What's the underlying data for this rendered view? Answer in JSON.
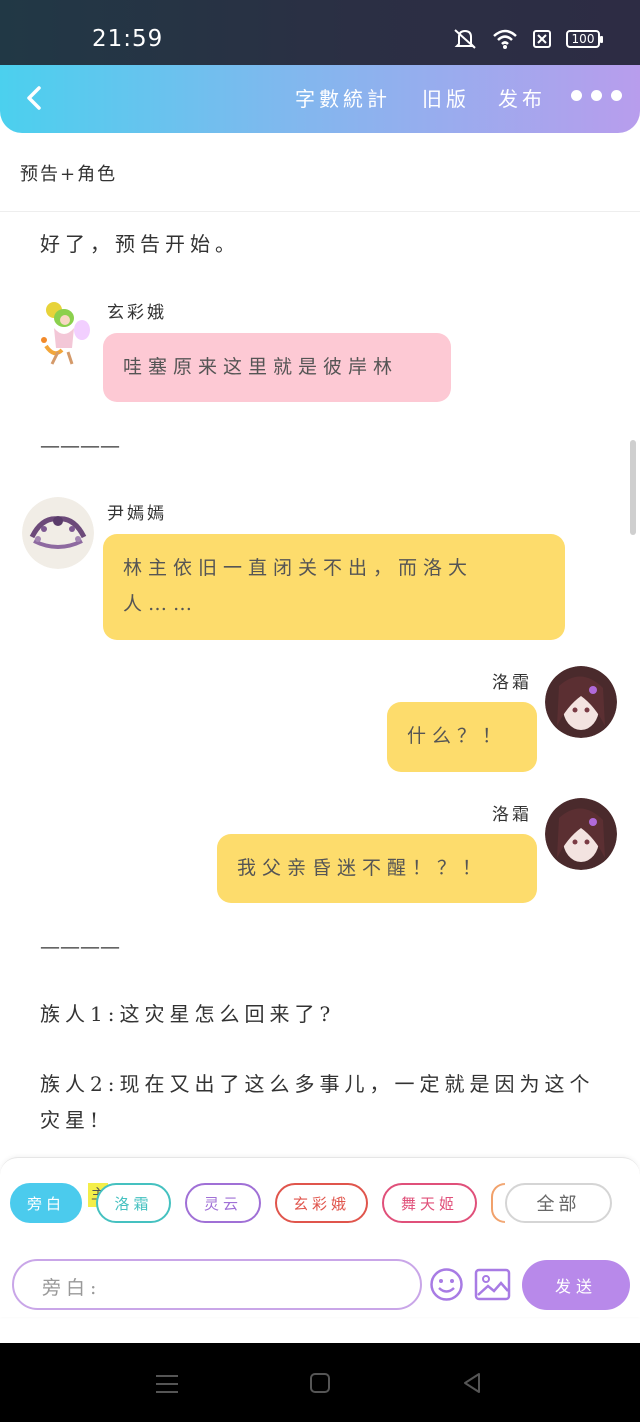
{
  "status": {
    "time": "21:59",
    "battery": "100"
  },
  "header": {
    "word_count": "字數統計",
    "old_version": "旧版",
    "publish": "发布"
  },
  "chapter_title": "预告+角色",
  "messages": {
    "narration_1": "好了，预告开始。",
    "msg1": {
      "name": "玄彩娥",
      "text": "哇塞原来这里就是彼岸林"
    },
    "separator": "————",
    "msg2": {
      "name": "尹嫣嫣",
      "text": "林主依旧一直闭关不出，而洛大人……"
    },
    "msg3": {
      "name": "洛霜",
      "text": "什么？！"
    },
    "msg4": {
      "name": "洛霜",
      "text": "我父亲昏迷不醒！？！"
    },
    "separator_2": "————",
    "narration_2": "族人1:这灾星怎么回来了?",
    "narration_3": "族人2:现在又出了这么多事儿，一定就是因为这个灾星!"
  },
  "role_chips": {
    "narrator": "旁白",
    "main_tag": "主",
    "c1": "洛霜",
    "c2": "灵云",
    "c3": "玄彩娥",
    "c4": "舞天姬",
    "all": "全部"
  },
  "composer": {
    "placeholder": "旁白:",
    "send": "发送"
  },
  "colors": {
    "header_start": "#4bd0ee",
    "header_end": "#b89ded",
    "pink_bubble": "#fdc9d4",
    "yellow_bubble": "#fddc6c",
    "send_button": "#b889ea"
  }
}
